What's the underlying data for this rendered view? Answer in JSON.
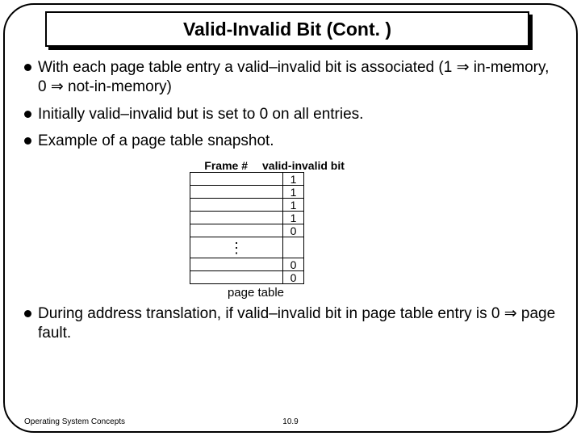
{
  "title": "Valid-Invalid Bit (Cont. )",
  "bullets": {
    "b1": "With each page table entry a valid–invalid bit is associated (1 ⇒ in-memory, 0 ⇒ not-in-memory)",
    "b2": "Initially valid–invalid but is set to 0 on all entries.",
    "b3": "Example of a page table snapshot.",
    "b4": "During address translation, if valid–invalid bit in page table entry is 0 ⇒ page fault."
  },
  "table": {
    "header_frame": "Frame #",
    "header_valid": "valid-invalid bit",
    "rows": [
      {
        "frame": "",
        "bit": "1"
      },
      {
        "frame": "",
        "bit": "1"
      },
      {
        "frame": "",
        "bit": "1"
      },
      {
        "frame": "",
        "bit": "1"
      },
      {
        "frame": "",
        "bit": "0"
      }
    ],
    "dots": "⋮",
    "rows2": [
      {
        "frame": "",
        "bit": "0"
      },
      {
        "frame": "",
        "bit": "0"
      }
    ],
    "caption": "page table"
  },
  "footer": {
    "left": "Operating System Concepts",
    "center": "10.9"
  }
}
